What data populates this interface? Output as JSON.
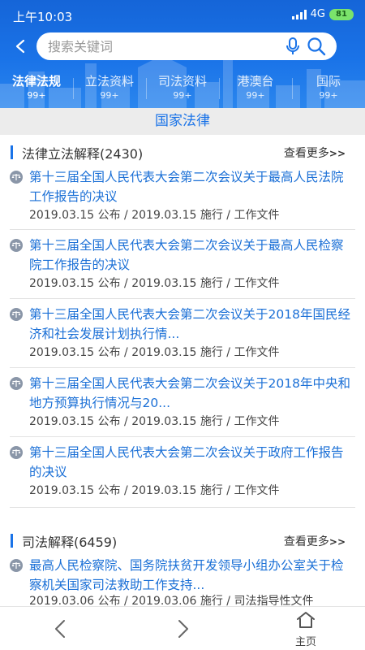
{
  "status_bar": {
    "time": "上午10:03",
    "network": "4G",
    "battery": "81"
  },
  "search": {
    "placeholder": "搜索关键词"
  },
  "tabs": [
    {
      "label": "法律法规",
      "count": "99+",
      "active": true
    },
    {
      "label": "立法资料",
      "count": "99+"
    },
    {
      "label": "司法资料",
      "count": "99+"
    },
    {
      "label": "港澳台",
      "count": "99+"
    },
    {
      "label": "国际",
      "count": "99+"
    }
  ],
  "banner": "国家法律",
  "sections": [
    {
      "title": "法律立法解释(2430)",
      "more": "查看更多",
      "items": [
        {
          "title": "第十三届全国人民代表大会第二次会议关于最高人民法院工作报告的决议",
          "meta": "2019.03.15 公布 / 2019.03.15 施行 / 工作文件"
        },
        {
          "title": "第十三届全国人民代表大会第二次会议关于最高人民检察院工作报告的决议",
          "meta": "2019.03.15 公布 / 2019.03.15 施行 / 工作文件"
        },
        {
          "title": "第十三届全国人民代表大会第二次会议关于2018年国民经济和社会发展计划执行情...",
          "meta": "2019.03.15 公布 / 2019.03.15 施行 / 工作文件"
        },
        {
          "title": "第十三届全国人民代表大会第二次会议关于2018年中央和地方预算执行情况与20...",
          "meta": "2019.03.15 公布 / 2019.03.15 施行 / 工作文件"
        },
        {
          "title": "第十三届全国人民代表大会第二次会议关于政府工作报告的决议",
          "meta": "2019.03.15 公布 / 2019.03.15 施行 / 工作文件"
        }
      ]
    },
    {
      "title": "司法解释(6459)",
      "more": "查看更多",
      "items": [
        {
          "title": "最高人民检察院、国务院扶贫开发领导小组办公室关于检察机关国家司法救助工作支持...",
          "meta": "2019.03.06 公布 / 2019.03.06 施行 / 司法指导性文件"
        }
      ]
    }
  ],
  "bottom_nav": {
    "home_label": "主页"
  },
  "colors": {
    "primary": "#1a73e8",
    "link": "#1a6fd6",
    "banner_bg": "#ececec"
  }
}
